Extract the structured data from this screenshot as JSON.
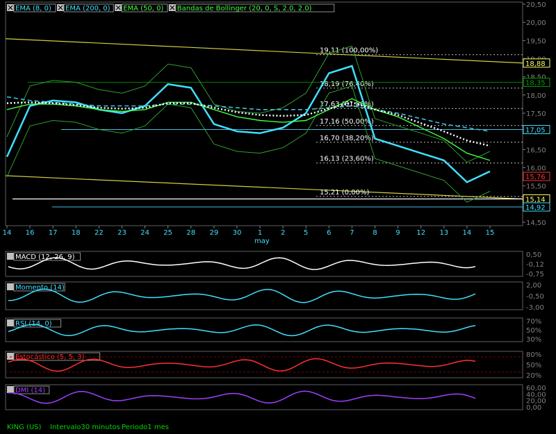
{
  "main_legend": [
    {
      "label": "EMA (8, 0)",
      "color": "#40e0ff"
    },
    {
      "label": "EMA (200, 0)",
      "color": "#40e0ff"
    },
    {
      "label": "EMA (50, 0)",
      "color": "#40ff40"
    },
    {
      "label": "Bandas de Bollinger (20, 0, S, 2.0, 2.0)",
      "color": "#40ff40"
    }
  ],
  "main_y_ticks": [
    "20,50",
    "20,00",
    "19,50",
    "19,00",
    "18,50",
    "18,00",
    "17,50",
    "17,00",
    "16,50",
    "16,00",
    "15,50",
    "15,00",
    "14,50"
  ],
  "x_ticks": [
    "14",
    "16",
    "17",
    "18",
    "22",
    "23",
    "24",
    "25",
    "28",
    "29",
    "30",
    "1",
    "2",
    "5",
    "6",
    "7",
    "8",
    "9",
    "12",
    "13",
    "14",
    "15"
  ],
  "x_month_label": "may",
  "fib_levels": [
    {
      "label": "19,11  (100,00%)",
      "value": 19.11
    },
    {
      "label": "18,19  (76,40%)",
      "value": 18.19
    },
    {
      "label": "17,63  (61,80%)",
      "value": 17.63
    },
    {
      "label": "17,16  (50,00%)",
      "value": 17.16
    },
    {
      "label": "16,70  (38,20%)",
      "value": 16.7
    },
    {
      "label": "16,13  (23,60%)",
      "value": 16.13
    },
    {
      "label": "15,21  (0,00%)",
      "value": 15.21
    }
  ],
  "price_tags": [
    {
      "label": "18,88",
      "value": 18.88,
      "color": "#ffff60"
    },
    {
      "label": "18,35",
      "value": 18.35,
      "color": "#00a000"
    },
    {
      "label": "17,05",
      "value": 17.05,
      "color": "#40e0ff"
    },
    {
      "label": "15,76",
      "value": 15.76,
      "color": "#ff3030"
    },
    {
      "label": "15,14",
      "value": 15.14,
      "color": "#ffff60"
    },
    {
      "label": "14,92",
      "value": 14.92,
      "color": "#40e0ff"
    }
  ],
  "panels": [
    {
      "label": "MACD (12, 26, 9)",
      "color": "#ffffff",
      "ticks": [
        "0,50",
        "-0,12",
        "-0,75"
      ]
    },
    {
      "label": "Momento (14)",
      "color": "#40e0ff",
      "ticks": [
        "2,00",
        "-0,50",
        "-3,00"
      ]
    },
    {
      "label": "RSI (14, 0)",
      "color": "#40e0ff",
      "ticks": [
        "70%",
        "50%",
        "30%"
      ]
    },
    {
      "label": "Estocástico (5, 5, 3)",
      "color": "#ff3030",
      "ticks": [
        "80%",
        "50%",
        "20%"
      ]
    },
    {
      "label": "DMI (14)",
      "color": "#a040ff",
      "ticks": [
        "60,00",
        "40,00",
        "20,00",
        "0,00"
      ]
    }
  ],
  "status_bar": {
    "symbol": "KING (US)",
    "interval": "Intervalo30 minutos",
    "period": "Periodo1 mes"
  },
  "chart_data": {
    "type": "line",
    "title": "",
    "x": [
      "14",
      "16",
      "17",
      "18",
      "22",
      "23",
      "24",
      "25",
      "28",
      "29",
      "30",
      "1",
      "2",
      "5",
      "6",
      "7",
      "8",
      "9",
      "12",
      "13",
      "14",
      "15"
    ],
    "ylim": [
      14.5,
      20.5
    ],
    "series": [
      {
        "name": "EMA (8, 0)",
        "values": [
          16.3,
          17.7,
          17.85,
          17.8,
          17.6,
          17.5,
          17.7,
          18.3,
          18.2,
          17.2,
          17.0,
          16.95,
          17.1,
          17.5,
          18.6,
          18.8,
          16.8,
          16.6,
          16.4,
          16.2,
          15.6,
          15.9
        ]
      },
      {
        "name": "EMA (200, 0)",
        "values": [
          17.95,
          17.85,
          17.8,
          17.75,
          17.7,
          17.7,
          17.7,
          17.75,
          17.75,
          17.7,
          17.65,
          17.6,
          17.6,
          17.6,
          17.65,
          17.7,
          17.6,
          17.5,
          17.35,
          17.2,
          17.1,
          17.0
        ]
      },
      {
        "name": "EMA (50, 0)",
        "values": [
          17.6,
          17.75,
          17.75,
          17.7,
          17.6,
          17.55,
          17.6,
          17.8,
          17.8,
          17.6,
          17.4,
          17.3,
          17.25,
          17.3,
          17.6,
          17.9,
          17.6,
          17.4,
          17.1,
          16.8,
          16.4,
          16.2
        ]
      }
    ]
  }
}
